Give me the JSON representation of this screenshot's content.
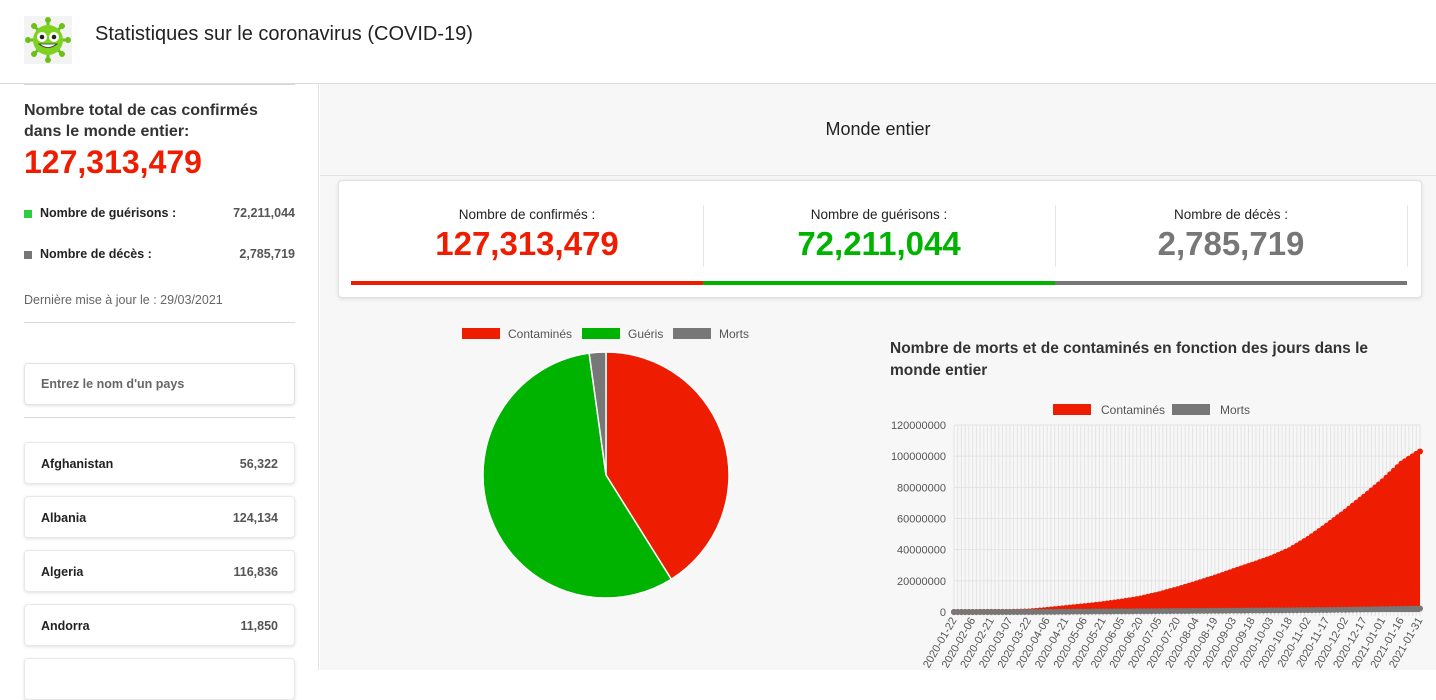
{
  "header": {
    "title": "Statistiques sur le coronavirus (COVID-19)",
    "logo_icon": "virus-mascot-icon"
  },
  "sidebar": {
    "total_label": "Nombre total de cas confirmés dans le monde entier:",
    "total_value": "127,313,479",
    "recovered_label": "Nombre de guérisons :",
    "recovered_value": "72,211,044",
    "deaths_label": "Nombre de décès :",
    "deaths_value": "2,785,719",
    "updated": "Dernière mise à jour le : 29/03/2021",
    "search_placeholder": "Entrez le nom d'un pays",
    "countries": [
      {
        "name": "Afghanistan",
        "value": "56,322"
      },
      {
        "name": "Albania",
        "value": "124,134"
      },
      {
        "name": "Algeria",
        "value": "116,836"
      },
      {
        "name": "Andorra",
        "value": "11,850"
      }
    ]
  },
  "main": {
    "title": "Monde entier",
    "kpis": [
      {
        "label": "Nombre de confirmés :",
        "value": "127,313,479",
        "color": "#ee1c00"
      },
      {
        "label": "Nombre de guérisons :",
        "value": "72,211,044",
        "color": "#00b300"
      },
      {
        "label": "Nombre de décès :",
        "value": "2,785,719",
        "color": "#777777"
      }
    ]
  },
  "colors": {
    "confirmed": "#ee1c00",
    "recovered": "#00b300",
    "deaths": "#777777"
  },
  "chart_data": [
    {
      "type": "pie",
      "categories": [
        "Contaminés",
        "Guéris",
        "Morts"
      ],
      "values": [
        52316716,
        72211044,
        2785719
      ],
      "legend": "top"
    },
    {
      "type": "area",
      "title": "Nombre de morts et de contaminés en fonction des jours dans le monde entier",
      "x": [
        "2020-01-22",
        "2020-02-06",
        "2020-02-21",
        "2020-03-07",
        "2020-03-22",
        "2020-04-06",
        "2020-04-21",
        "2020-05-06",
        "2020-05-21",
        "2020-06-05",
        "2020-06-20",
        "2020-07-05",
        "2020-07-20",
        "2020-08-04",
        "2020-08-19",
        "2020-09-03",
        "2020-09-18",
        "2020-10-03",
        "2020-10-18",
        "2020-11-02",
        "2020-11-17",
        "2020-12-02",
        "2020-12-17",
        "2021-01-01",
        "2021-01-16",
        "2021-01-31"
      ],
      "series": [
        {
          "name": "Contaminés",
          "values": [
            555,
            28000,
            77000,
            105000,
            338000,
            1350000,
            2550000,
            3750000,
            5100000,
            6700000,
            8700000,
            11400000,
            14700000,
            18300000,
            22100000,
            26300000,
            30300000,
            34500000,
            39700000,
            46900000,
            55400000,
            64400000,
            74000000,
            83900000,
            95200000,
            103000000
          ]
        },
        {
          "name": "Morts",
          "values": [
            17,
            600,
            2250,
            3550,
            14600,
            74000,
            178000,
            262000,
            330000,
            395000,
            466000,
            535000,
            622000,
            707000,
            794000,
            869000,
            946000,
            1030000,
            1110000,
            1200000,
            1320000,
            1480000,
            1650000,
            1820000,
            2020000,
            2230000
          ]
        }
      ],
      "ylim": [
        0,
        120000000
      ],
      "yticks": [
        "120000000",
        "100000000",
        "80000000",
        "60000000",
        "40000000",
        "20000000",
        "0"
      ],
      "legend": "top",
      "grid": true
    }
  ]
}
